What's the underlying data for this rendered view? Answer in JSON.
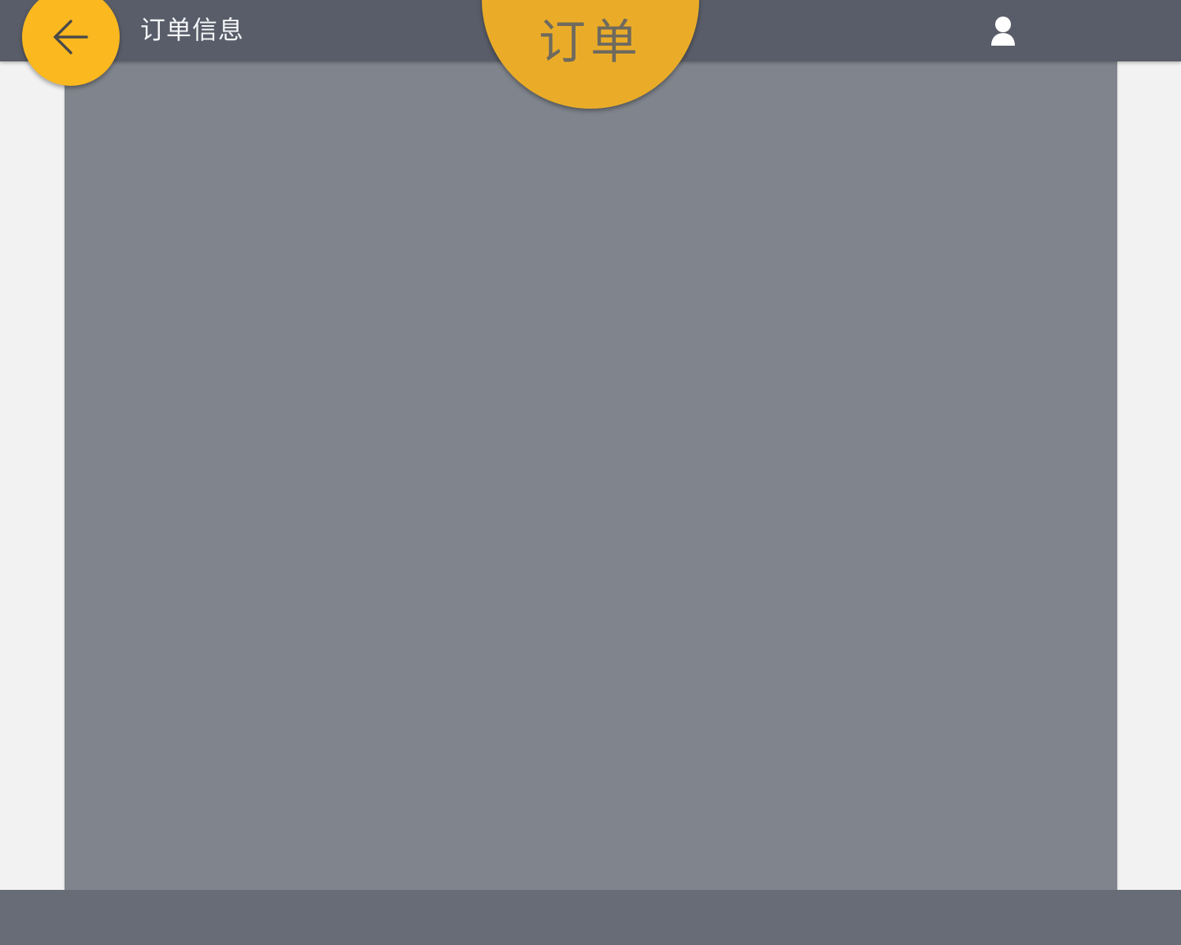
{
  "header": {
    "title": "订单信息",
    "back_icon": "arrow-left-icon",
    "user_icon": "user-icon",
    "background_color": "#595d69"
  },
  "badge": {
    "label": "订单",
    "color": "#eaac28"
  },
  "colors": {
    "accent": "#fbb81f",
    "content_panel": "#80858d",
    "bottom_bar": "#686c76",
    "page_background": "#f2f2f2"
  }
}
